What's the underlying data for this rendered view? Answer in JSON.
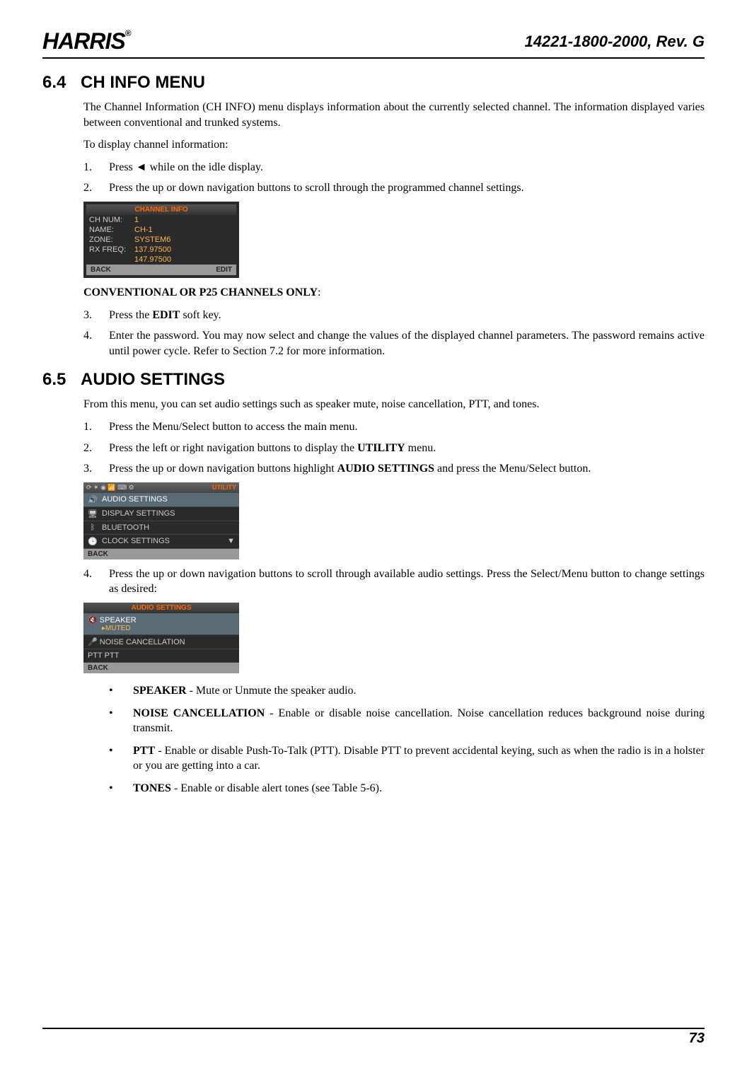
{
  "header": {
    "logo": "HARRIS",
    "doc_id": "14221-1800-2000, Rev. G"
  },
  "section_64": {
    "number": "6.4",
    "title": "CH INFO MENU",
    "para1": "The Channel Information (CH INFO) menu displays information about the currently selected channel. The information displayed varies between conventional and trunked systems.",
    "para2": "To display channel information:",
    "steps": {
      "s1_pre": "Press ",
      "s1_post": " while on the idle display.",
      "s2": "Press the up or down navigation buttons to scroll through the programmed channel settings."
    },
    "screenshot": {
      "title": "CHANNEL INFO",
      "rows": [
        {
          "label": "CH NUM:",
          "value": "1"
        },
        {
          "label": "NAME:",
          "value": "CH-1"
        },
        {
          "label": "ZONE:",
          "value": "SYSTEM6"
        },
        {
          "label": "RX FREQ:",
          "value": "137.97500"
        },
        {
          "label": "",
          "value": "147.97500"
        }
      ],
      "bottom_left": "BACK",
      "bottom_right": "EDIT"
    },
    "conv_heading": "CONVENTIONAL OR P25 CHANNELS ONLY",
    "s3_pre": "Press the ",
    "s3_bold": "EDIT",
    "s3_post": " soft key.",
    "s4": "Enter the password. You may now select and change the values of the displayed channel parameters. The password remains active until power cycle. Refer to Section 7.2 for more information."
  },
  "section_65": {
    "number": "6.5",
    "title": "AUDIO SETTINGS",
    "para1": "From this menu, you can set audio settings such as speaker mute, noise cancellation, PTT, and tones.",
    "s1": "Press the Menu/Select button to access the main menu.",
    "s2_pre": "Press the left or right navigation buttons to display the ",
    "s2_bold": "UTILITY",
    "s2_post": " menu.",
    "s3_pre": "Press the up or down navigation buttons highlight ",
    "s3_bold": "AUDIO SETTINGS",
    "s3_post": " and press the Menu/Select button.",
    "utility_screen": {
      "topbar_icons": "⟳ ✶ ◉ 📶 ⌨ ⚙",
      "topbar_label": "UTILITY",
      "items": [
        {
          "icon": "🔊",
          "label": "AUDIO SETTINGS",
          "highlight": true
        },
        {
          "icon": "🖥",
          "label": "DISPLAY SETTINGS",
          "highlight": false
        },
        {
          "icon": "ᛒ",
          "label": "BLUETOOTH",
          "highlight": false
        },
        {
          "icon": "🕒",
          "label": "CLOCK SETTINGS",
          "highlight": false
        }
      ],
      "bottom_left": "BACK",
      "bottom_right": ""
    },
    "s4": "Press the up or down navigation buttons to scroll through available audio settings. Press the Select/Menu button to change settings as desired:",
    "audio_screen": {
      "title": "AUDIO SETTINGS",
      "items": [
        {
          "label": "SPEAKER",
          "sub": "▸MUTED",
          "highlight": true
        },
        {
          "label": "NOISE CANCELLATION",
          "sub": "",
          "highlight": false
        },
        {
          "label": "PTT",
          "sub": "",
          "highlight": false
        }
      ],
      "bottom_left": "BACK",
      "bottom_right": ""
    },
    "bullets": {
      "b1_bold": "SPEAKER",
      "b1_text": " - Mute or Unmute the speaker audio.",
      "b2_bold": "NOISE CANCELLATION",
      "b2_text": " - Enable or disable noise cancellation. Noise cancellation reduces background noise during transmit.",
      "b3_bold": "PTT",
      "b3_text": " - Enable or disable Push-To-Talk (PTT). Disable PTT to prevent accidental keying, such as when the radio is in a holster or you are getting into a car.",
      "b4_bold": "TONES",
      "b4_text": " - Enable or disable alert tones (see Table 5-6)."
    }
  },
  "footer": {
    "page": "73"
  }
}
